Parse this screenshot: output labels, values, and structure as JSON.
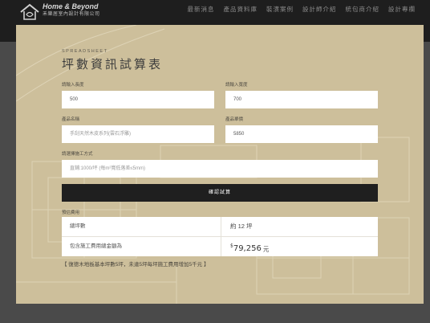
{
  "header": {
    "logo_title": "Home & Beyond",
    "logo_subtitle": "禾樂居室內設計有限公司",
    "nav": [
      "最新消息",
      "產品資料庫",
      "裝潢案例",
      "設計師介紹",
      "統包商介紹",
      "設計專欄"
    ]
  },
  "form": {
    "eyebrow": "SPREADSHEET",
    "title": "坪數資訊試算表",
    "length_label": "請輸入長度",
    "length_value": "500",
    "width_label": "請輸入寬度",
    "width_value": "700",
    "product_label": "產品名稱",
    "product_value": "手刮天然木皮系列(雲石浮雕)",
    "price_label": "產品單價",
    "price_value": "5850",
    "method_label": "請選擇施工方式",
    "method_value": "直鋪:1000/坪 (每m²寬低落差≤5mm)",
    "submit_label": "確認試算"
  },
  "result": {
    "label": "預估費用",
    "total_area_label": "總坪數",
    "total_area_value": "約 12 坪",
    "total_cost_label": "包含施工費用總金額為",
    "currency": "$",
    "total_cost_value": "79,256",
    "total_cost_unit": "元"
  },
  "note": "【 復德木地板基本坪數5坪，未達5坪每坪施工費用增加5千元 】",
  "colors": {
    "panel": "#cdbf9b",
    "button": "#1f1f1f",
    "topbar": "#1e1e1e"
  }
}
